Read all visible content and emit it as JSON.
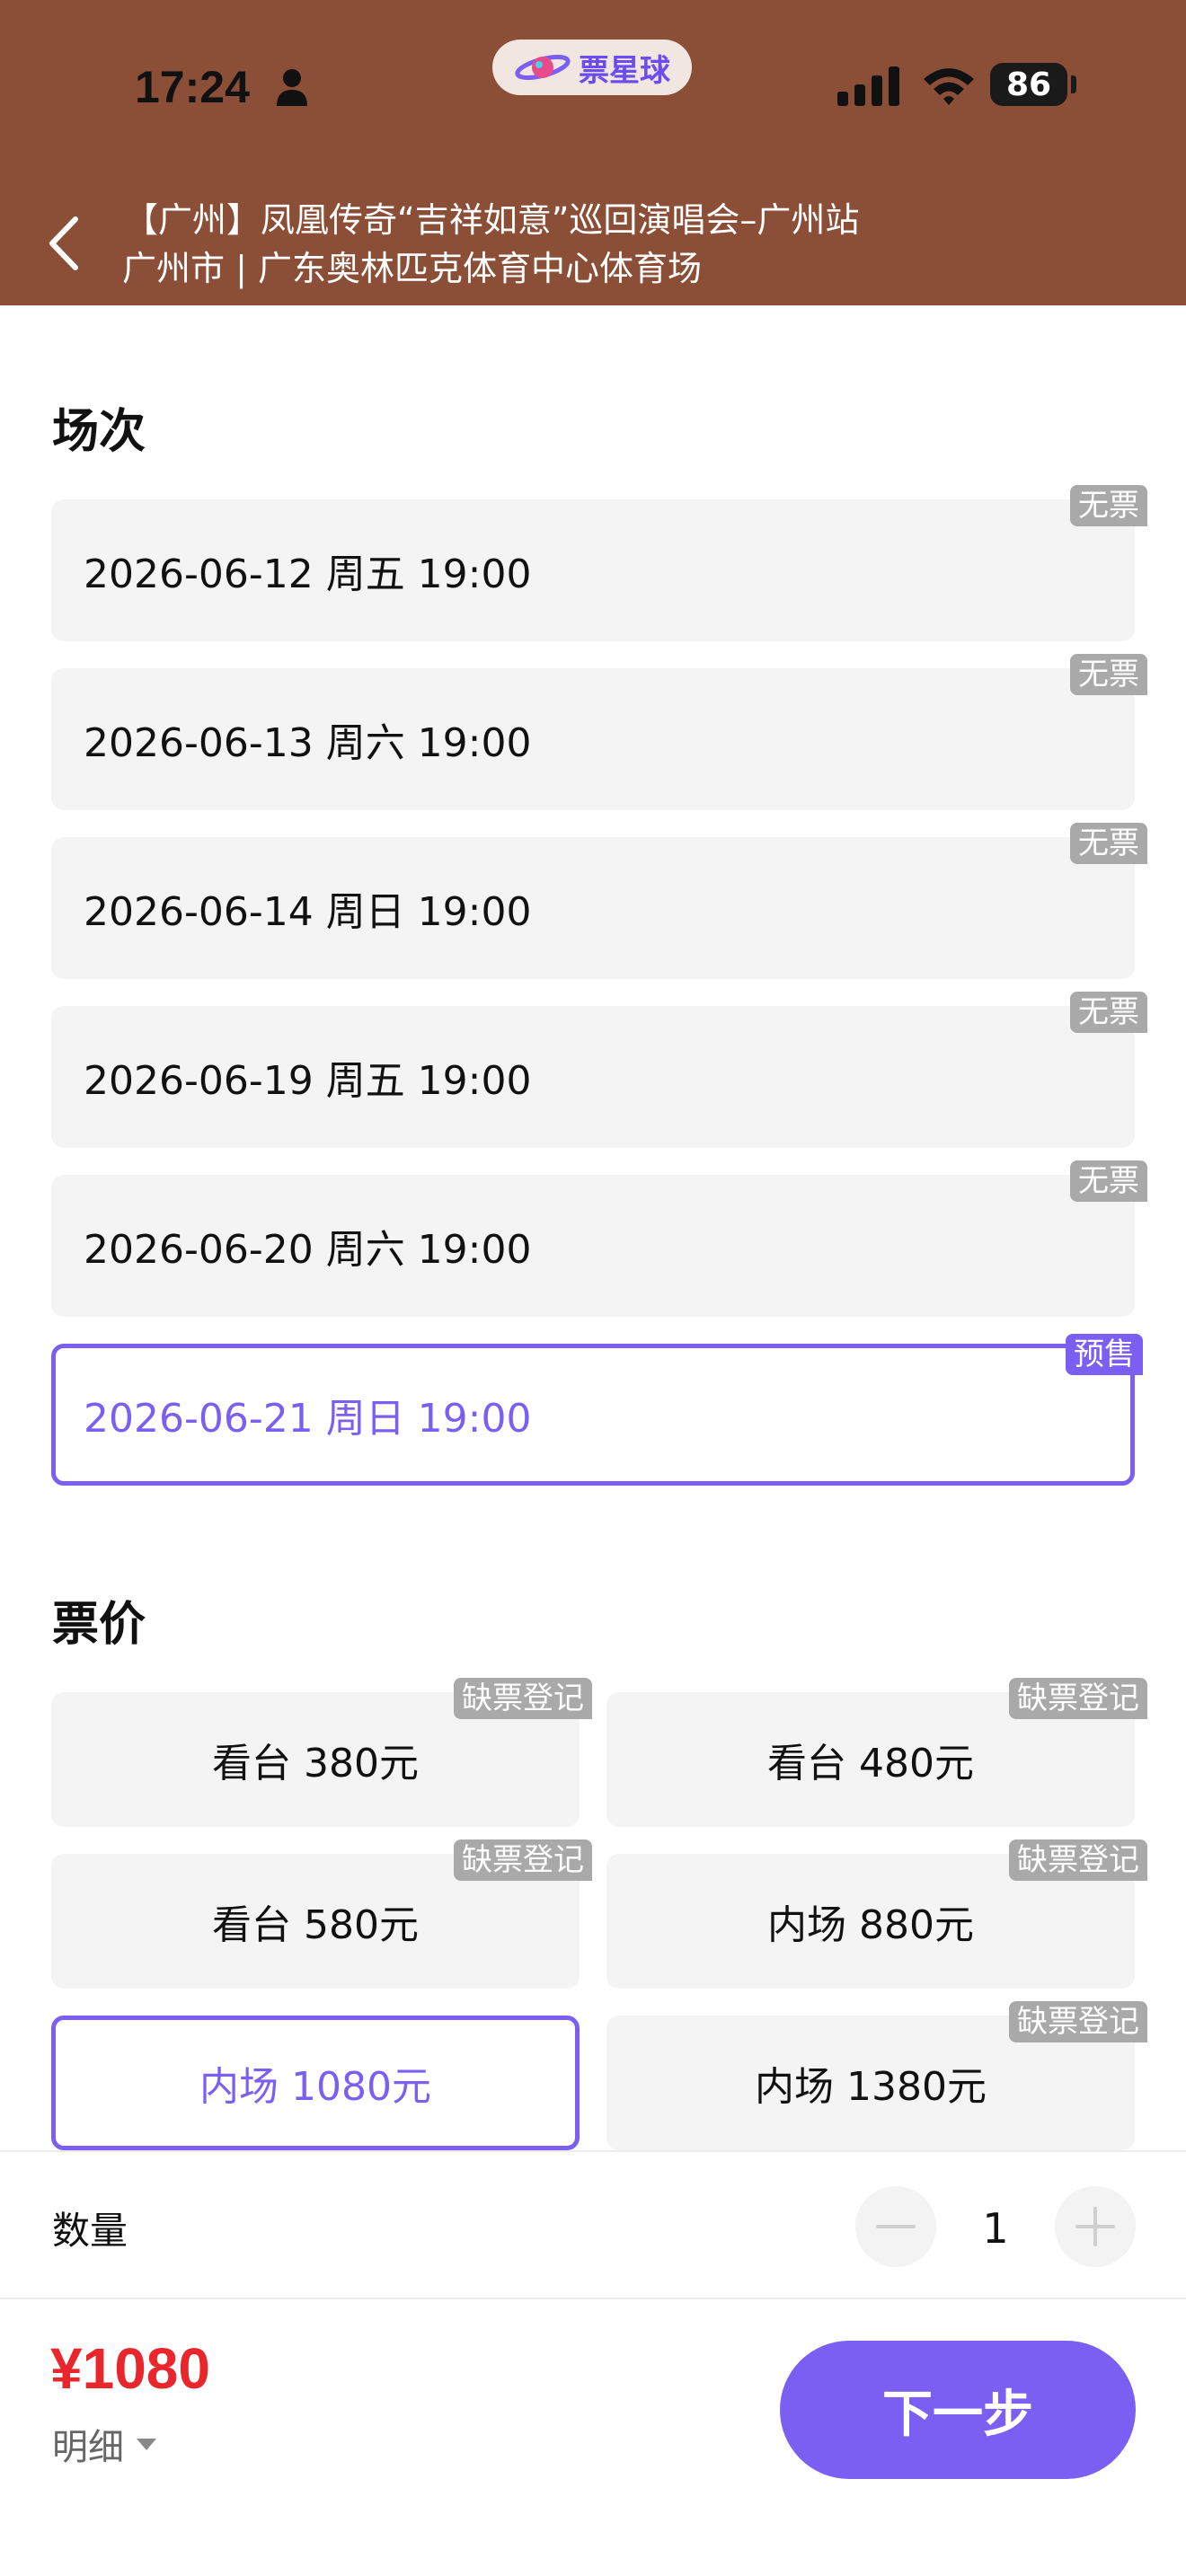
{
  "status_bar": {
    "time": "17:24",
    "battery": "86"
  },
  "app": {
    "name": "票星球",
    "brand_color": "#7a5ff2"
  },
  "header": {
    "title": "【广州】凤凰传奇“吉祥如意”巡回演唱会–广州站",
    "venue": "广州市 | 广东奥林匹克体育中心体育场",
    "background": "#8B4F38"
  },
  "sessions": {
    "heading": "场次",
    "items": [
      {
        "label": "2026-06-12 周五 19:00",
        "tag": "无票"
      },
      {
        "label": "2026-06-13 周六 19:00",
        "tag": "无票"
      },
      {
        "label": "2026-06-14 周日 19:00",
        "tag": "无票"
      },
      {
        "label": "2026-06-19 周五 19:00",
        "tag": "无票"
      },
      {
        "label": "2026-06-20 周六 19:00",
        "tag": "无票"
      },
      {
        "label": "2026-06-21 周日 19:00",
        "tag": "预售",
        "selected": true
      }
    ]
  },
  "prices": {
    "heading": "票价",
    "items": [
      {
        "label": "看台 380元",
        "tag": "缺票登记"
      },
      {
        "label": "看台 480元",
        "tag": "缺票登记"
      },
      {
        "label": "看台 580元",
        "tag": "缺票登记"
      },
      {
        "label": "内场 880元",
        "tag": "缺票登记"
      },
      {
        "label": "内场 1080元",
        "tag": "",
        "selected": true
      },
      {
        "label": "内场 1380元",
        "tag": "缺票登记"
      }
    ]
  },
  "quantity": {
    "label": "数量",
    "value": "1"
  },
  "footer": {
    "total": "¥1080",
    "detail": "明细",
    "next": "下一步",
    "price_color": "#e8262c"
  }
}
